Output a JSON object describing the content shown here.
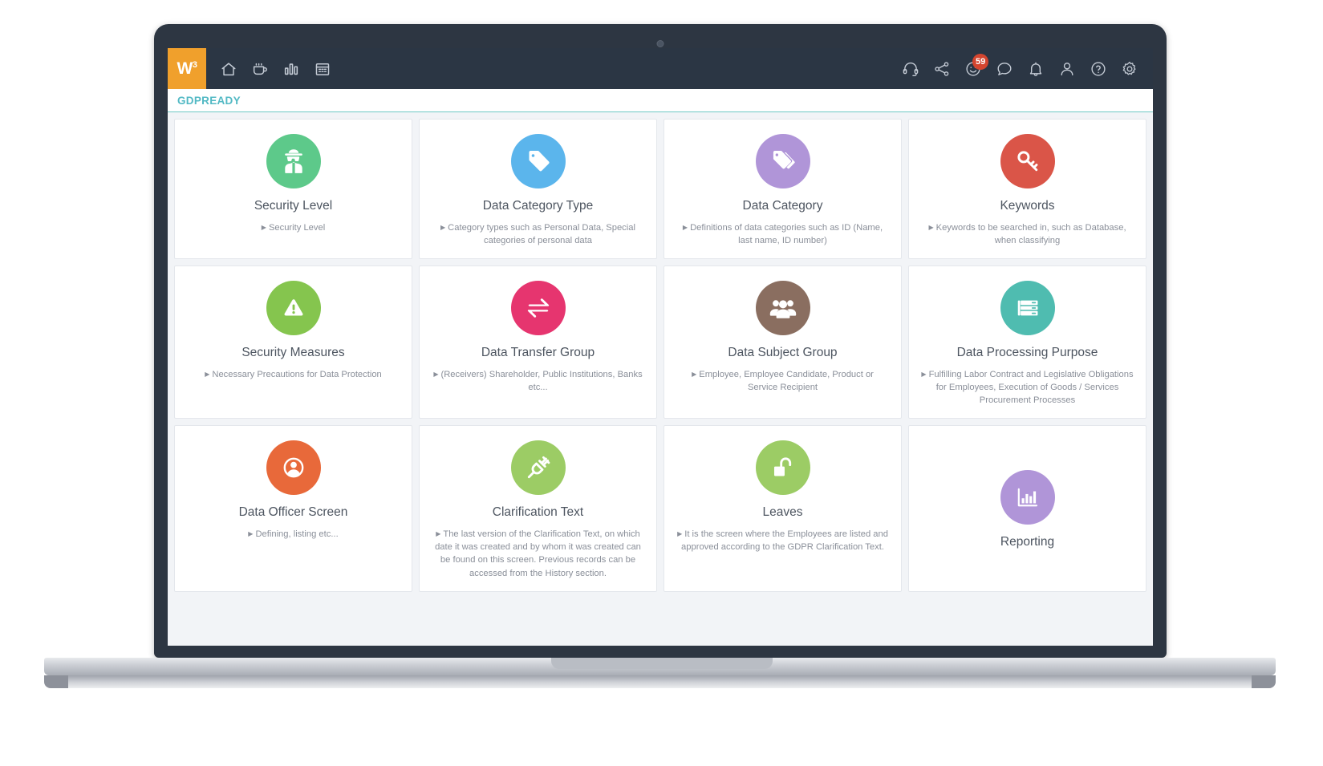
{
  "header": {
    "brand": {
      "text": "W",
      "superscript": "3",
      "name": "w3-logo"
    },
    "nav_items": [
      {
        "icon": "home-icon",
        "label": "Home"
      },
      {
        "icon": "coffee-cup-icon",
        "label": "Break"
      },
      {
        "icon": "bar-chart-icon",
        "label": "Reports"
      },
      {
        "icon": "calendar-icon",
        "label": "Calendar"
      }
    ],
    "actions": [
      {
        "icon": "headset-icon",
        "label": "Support"
      },
      {
        "icon": "share-nodes-icon",
        "label": "Share"
      },
      {
        "icon": "smiley-face-icon",
        "label": "Feedback",
        "badge": "59"
      },
      {
        "icon": "chat-bubble-icon",
        "label": "Messages"
      },
      {
        "icon": "bell-icon",
        "label": "Notifications"
      },
      {
        "icon": "user-icon",
        "label": "Profile"
      },
      {
        "icon": "question-circle-icon",
        "label": "Help"
      },
      {
        "icon": "gear-icon",
        "label": "Settings"
      }
    ],
    "badge_value": "59"
  },
  "title_bar": {
    "title": "GDPREADY"
  },
  "colors": {
    "brand_orange": "#f0a02c",
    "header_bg": "#2b3644",
    "title_accent": "#52b9c4",
    "badge_red": "#d4452f",
    "page_bg": "#f2f4f7"
  },
  "cards": [
    {
      "id": "security-level",
      "title": "Security Level",
      "desc": "Security Level",
      "icon": "spy-agent-icon",
      "color": "#5dc98a"
    },
    {
      "id": "data-category-type",
      "title": "Data Category Type",
      "desc": "Category types such as Personal Data, Special categories of personal data",
      "icon": "tag-icon",
      "color": "#5bb5ec"
    },
    {
      "id": "data-category",
      "title": "Data Category",
      "desc": "Definitions of data categories such as ID (Name, last name, ID number)",
      "icon": "double-tag-icon",
      "color": "#b095d8"
    },
    {
      "id": "keywords",
      "title": "Keywords",
      "desc": "Keywords to be searched in, such as Database, when classifying",
      "icon": "key-icon",
      "color": "#da5548"
    },
    {
      "id": "security-measures",
      "title": "Security Measures",
      "desc": "Necessary Precautions for Data Protection",
      "icon": "warning-triangle-icon",
      "color": "#85c54e"
    },
    {
      "id": "data-transfer-group",
      "title": "Data Transfer Group",
      "desc": "(Receivers) Shareholder, Public Institutions, Banks etc...",
      "icon": "exchange-arrows-icon",
      "color": "#e6356f"
    },
    {
      "id": "data-subject-group",
      "title": "Data Subject Group",
      "desc": "Employee, Employee Candidate, Product or Service Recipient",
      "icon": "users-group-icon",
      "color": "#8a6e60"
    },
    {
      "id": "data-processing-purpose",
      "title": "Data Processing Purpose",
      "desc": "Fulfilling Labor Contract and Legislative Obligations for Employees, Execution of Goods / Services Procurement Processes",
      "icon": "server-list-icon",
      "color": "#4fbcb0"
    },
    {
      "id": "data-officer-screen",
      "title": "Data Officer Screen",
      "desc": "Defining, listing etc...",
      "icon": "user-circle-icon",
      "color": "#e8693a"
    },
    {
      "id": "clarification-text",
      "title": "Clarification Text",
      "desc": "The last version of the Clarification Text, on which date it was created and by whom it was created can be found on this screen. Previous records can be accessed from the History section.",
      "icon": "power-plug-icon",
      "color": "#9ccc65"
    },
    {
      "id": "leaves",
      "title": "Leaves",
      "desc": "It is the screen where the Employees are listed and approved according to the GDPR Clarification Text.",
      "icon": "unlock-icon",
      "color": "#9ccc65"
    },
    {
      "id": "reporting",
      "title": "Reporting",
      "desc": "",
      "icon": "bar-chart-report-icon",
      "color": "#b095d8"
    }
  ]
}
